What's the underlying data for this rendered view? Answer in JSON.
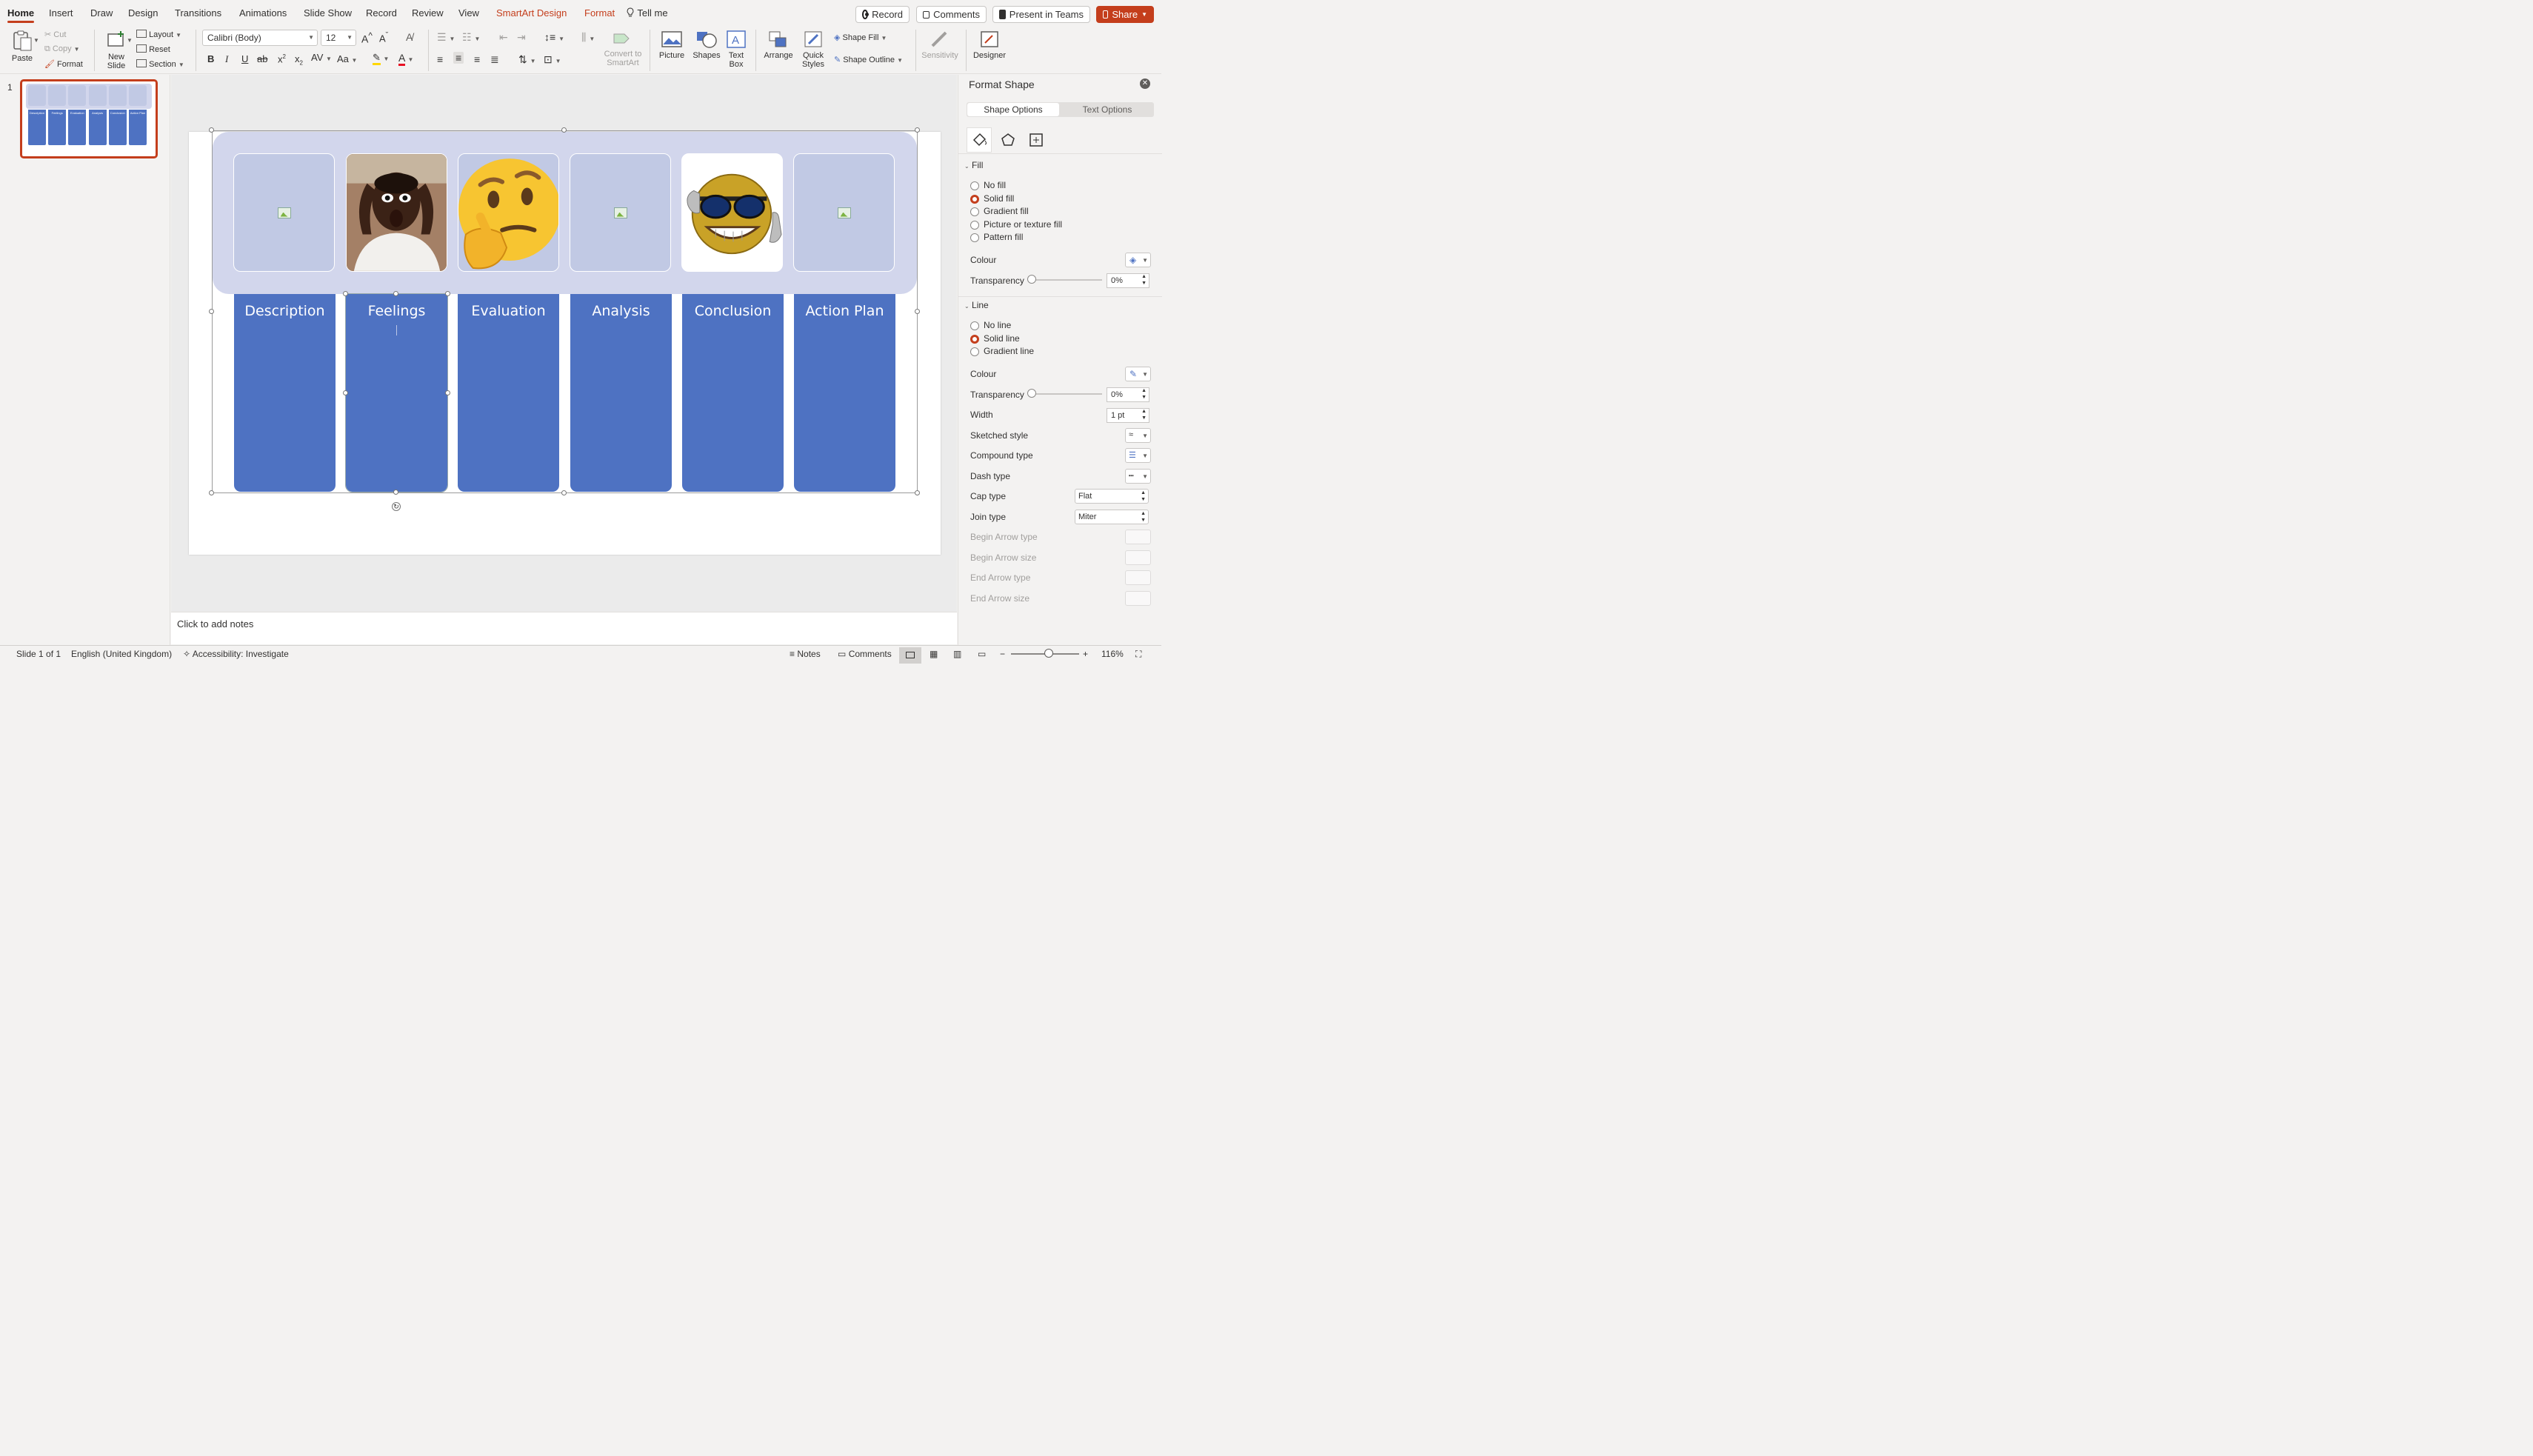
{
  "tabs": [
    "Home",
    "Insert",
    "Draw",
    "Design",
    "Transitions",
    "Animations",
    "Slide Show",
    "Record",
    "Review",
    "View",
    "SmartArt Design",
    "Format"
  ],
  "tell_me": "Tell me",
  "top_buttons": {
    "record": "Record",
    "comments": "Comments",
    "present": "Present in Teams",
    "share": "Share"
  },
  "ribbon": {
    "paste": "Paste",
    "cut": "Cut",
    "copy": "Copy",
    "format": "Format",
    "new_slide": "New Slide",
    "layout": "Layout",
    "reset": "Reset",
    "section": "Section",
    "font_name": "Calibri (Body)",
    "font_size": "12",
    "convert": "Convert to SmartArt",
    "picture": "Picture",
    "shapes": "Shapes",
    "text_box": "Text Box",
    "arrange": "Arrange",
    "quick_styles": "Quick Styles",
    "shape_fill": "Shape Fill",
    "shape_outline": "Shape Outline",
    "sensitivity": "Sensitivity",
    "designer": "Designer"
  },
  "thumb": {
    "number": "1",
    "labels": [
      "Description",
      "Feelings",
      "Evaluation",
      "Analysis",
      "Conclusion",
      "Action Plan"
    ]
  },
  "slide": {
    "boxes": [
      "Description",
      "Feelings",
      "Evaluation",
      "Analysis",
      "Conclusion",
      "Action Plan"
    ]
  },
  "notes_placeholder": "Click to add notes",
  "pane": {
    "title": "Format Shape",
    "tab_shape": "Shape Options",
    "tab_text": "Text Options",
    "fill_header": "Fill",
    "fill_options": [
      "No fill",
      "Solid fill",
      "Gradient fill",
      "Picture or texture fill",
      "Pattern fill"
    ],
    "fill_selected": "Solid fill",
    "colour": "Colour",
    "transparency": "Transparency",
    "fill_transparency": "0%",
    "line_header": "Line",
    "line_options": [
      "No line",
      "Solid line",
      "Gradient line"
    ],
    "line_selected": "Solid line",
    "line_transparency": "0%",
    "width": "Width",
    "width_value": "1 pt",
    "sketched": "Sketched style",
    "compound": "Compound type",
    "dash": "Dash type",
    "cap": "Cap type",
    "cap_value": "Flat",
    "join": "Join type",
    "join_value": "Miter",
    "begin_arrow_type": "Begin Arrow type",
    "begin_arrow_size": "Begin Arrow size",
    "end_arrow_type": "End Arrow type",
    "end_arrow_size": "End Arrow size"
  },
  "status": {
    "slide": "Slide 1 of 1",
    "language": "English (United Kingdom)",
    "accessibility": "Accessibility: Investigate",
    "notes": "Notes",
    "comments": "Comments",
    "zoom": "116%",
    "zoom_level": 0.55
  },
  "colors": {
    "accent": "#c43e1c",
    "box_fill": "#4e72c2",
    "band_fill": "#d2d6ec",
    "placeholder_fill": "#c1c9e4"
  }
}
